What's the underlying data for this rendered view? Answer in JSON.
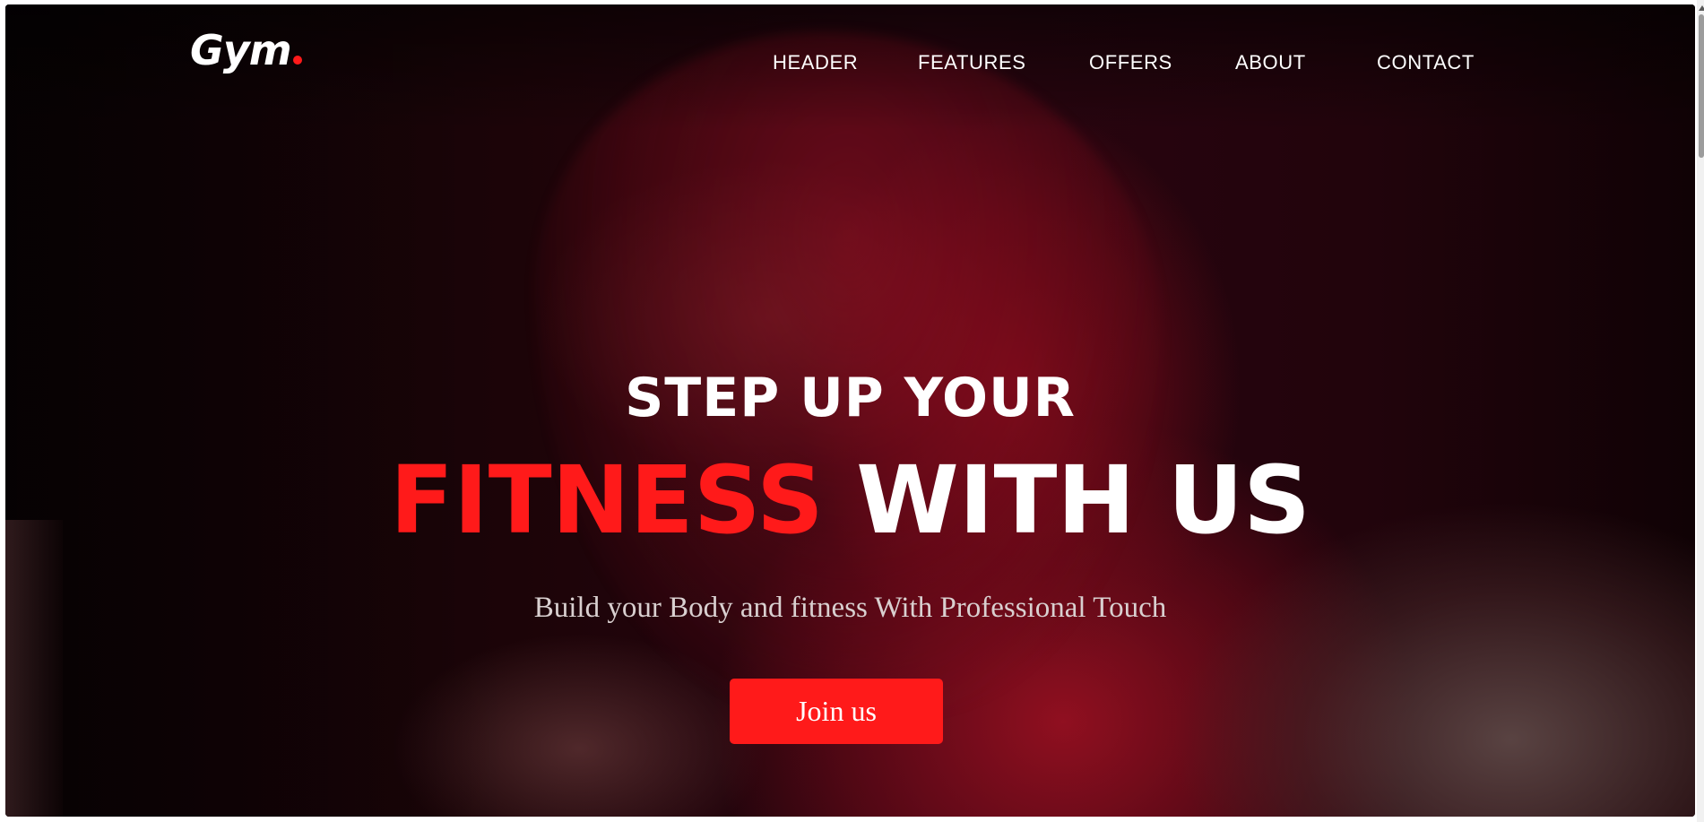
{
  "brand": {
    "logo_text": "Gym",
    "accent_color": "#ff1a1a"
  },
  "nav": {
    "items": [
      {
        "label": "HEADER"
      },
      {
        "label": "FEATURES"
      },
      {
        "label": "OFFERS"
      },
      {
        "label": "ABOUT"
      },
      {
        "label": "CONTACT"
      }
    ]
  },
  "hero": {
    "headline_top": "STEP UP YOUR",
    "headline_accent": "FITNESS",
    "headline_rest": " WITH US",
    "subtitle": "Build your Body and fitness With Professional Touch",
    "cta_label": "Join us"
  },
  "icons": {
    "scrollbar": "vertical-scrollbar"
  }
}
